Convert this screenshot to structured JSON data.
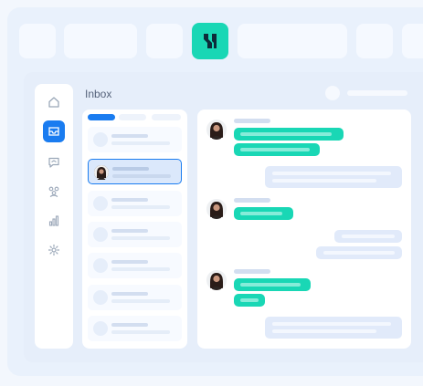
{
  "inbox": {
    "title": "Inbox"
  },
  "sidebar": {
    "items": [
      {
        "icon": "home-icon",
        "active": false
      },
      {
        "icon": "inbox-icon",
        "active": true
      },
      {
        "icon": "chat-icon",
        "active": false
      },
      {
        "icon": "contacts-icon",
        "active": false
      },
      {
        "icon": "reports-icon",
        "active": false
      },
      {
        "icon": "settings-icon",
        "active": false
      }
    ]
  },
  "colors": {
    "accent": "#1a7cf0",
    "brand": "#19d7b5",
    "outgoing_bubble": "#e1eafa"
  },
  "conversation_list": {
    "selected_index": 1
  }
}
